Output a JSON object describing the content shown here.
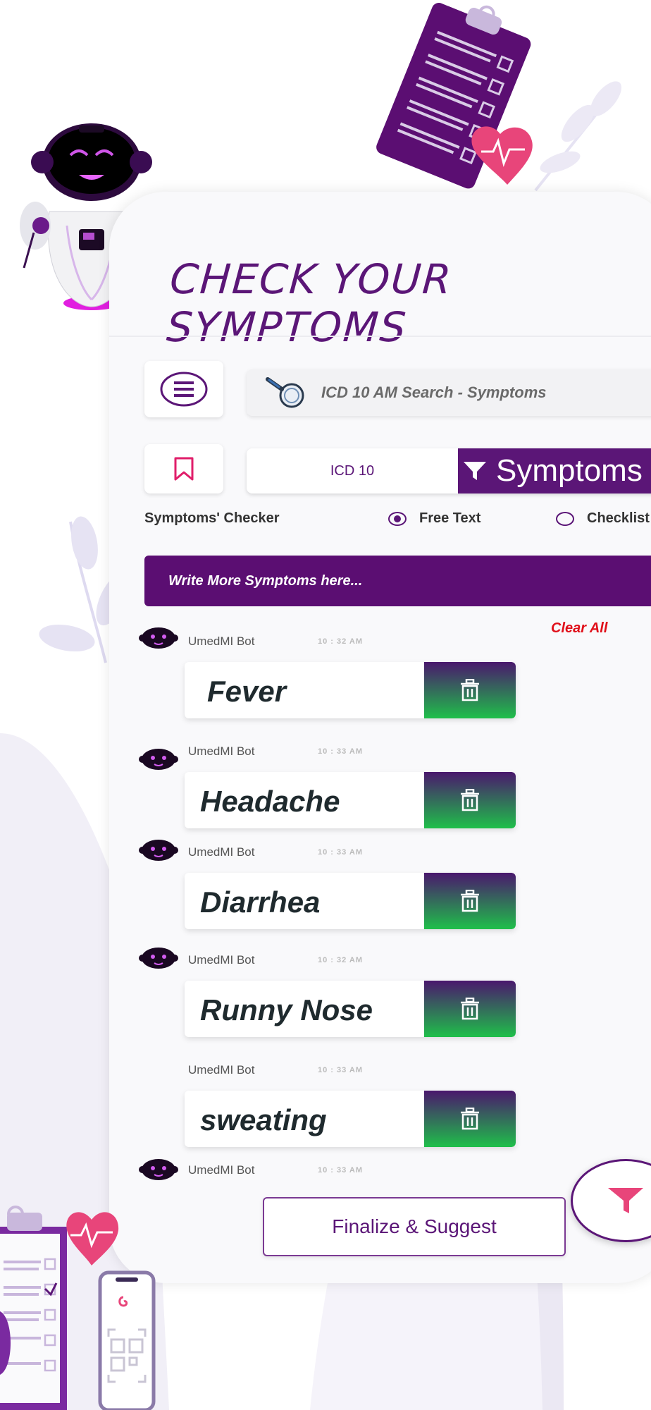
{
  "page": {
    "title": "CHECK YOUR SYMPTOMS"
  },
  "search": {
    "placeholder": "ICD 10 AM Search - Symptoms"
  },
  "tabs": {
    "icd_label": "ICD 10",
    "symptoms_label": "Symptoms"
  },
  "checker": {
    "label": "Symptoms' Checker",
    "free_text_label": "Free Text",
    "checklist_label": "Checklist",
    "selected": "Free Text"
  },
  "input": {
    "placeholder": "Write More Symptoms here..."
  },
  "clear_all_label": "Clear All",
  "messages": [
    {
      "sender": "UmedMI Bot",
      "time": "10 : 32 AM",
      "symptom": "Fever"
    },
    {
      "sender": "UmedMI Bot",
      "time": "10 : 33 AM",
      "symptom": "Headache"
    },
    {
      "sender": "UmedMI Bot",
      "time": "10 : 33 AM",
      "symptom": "Diarrhea"
    },
    {
      "sender": "UmedMI Bot",
      "time": "10 : 32 AM",
      "symptom": "Runny Nose"
    },
    {
      "sender": "UmedMI Bot",
      "time": "10 : 33 AM",
      "symptom": "sweating"
    },
    {
      "sender": "UmedMI Bot",
      "time": "10 : 33 AM"
    }
  ],
  "finalize_label": "Finalize & Suggest",
  "colors": {
    "primary_purple": "#5b1677",
    "accent_pink": "#e8457a",
    "clear_red": "#e0101a",
    "delete_gradient_top": "#4a186d",
    "delete_gradient_bottom": "#1fbf4a"
  },
  "icons": {
    "menu": "menu-lines-icon",
    "search": "magnifier-icon",
    "bookmark": "bookmark-icon",
    "filter": "filter-icon",
    "delete": "trash-icon",
    "bot": "robot-head-icon"
  }
}
